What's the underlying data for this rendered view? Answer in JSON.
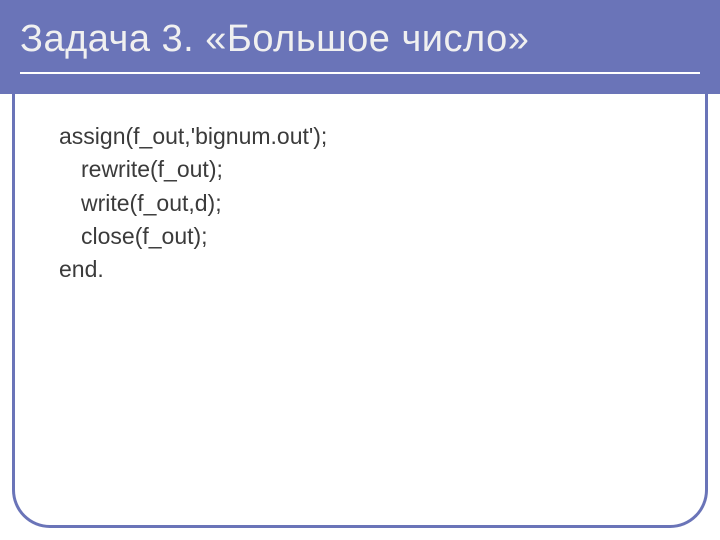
{
  "slide": {
    "title": "Задача 3. «Большое число»",
    "code": {
      "l1": "assign(f_out,'bignum.out');",
      "l2": "rewrite(f_out);",
      "l3": "write(f_out,d);",
      "l4": "close(f_out);",
      "l5": "end."
    }
  },
  "colors": {
    "accent": "#6a74b8",
    "text": "#3b3b3b",
    "titleText": "#f0f0f0"
  }
}
